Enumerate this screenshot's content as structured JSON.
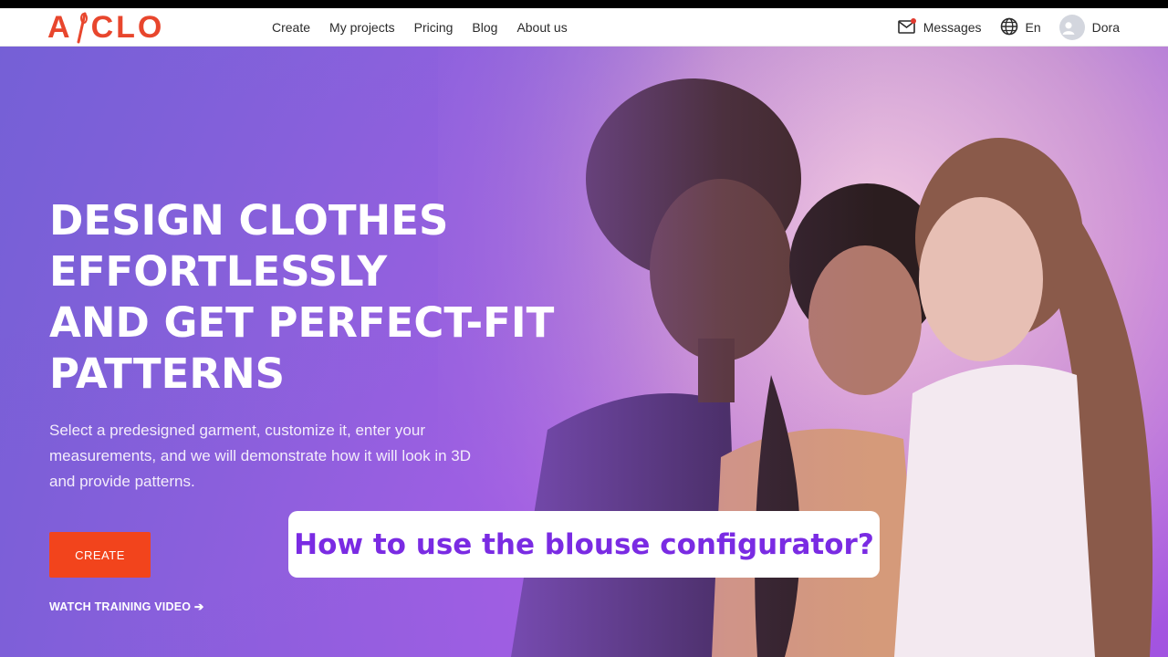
{
  "brand": {
    "logo_text": "A CLO",
    "logo_left": "A",
    "logo_right": "CLO",
    "accent": "#e8462d"
  },
  "nav": {
    "items": [
      "Create",
      "My projects",
      "Pricing",
      "Blog",
      "About us"
    ]
  },
  "right_nav": {
    "messages": "Messages",
    "language": "En",
    "user": "Dora",
    "notification_dot": "#e03a2f"
  },
  "hero": {
    "headline_lines": [
      "DESIGN CLOTHES",
      "EFFORTLESSLY",
      "AND GET PERFECT-FIT",
      "PATTERNS"
    ],
    "subtext_lines": [
      "Select a predesigned garment, customize it, enter your",
      "measurements, and we will demonstrate how it will look in 3D",
      "and provide patterns."
    ],
    "cta_label": "CREATE",
    "cta_color": "#f2441c",
    "watch_label": "WATCH TRAINING VIDEO ➔"
  },
  "caption": {
    "text": "How to use the blouse configurator?",
    "color": "#7a2be3"
  },
  "icons": {
    "messages": "envelope-icon",
    "language": "globe-icon",
    "user": "user-avatar-icon"
  }
}
